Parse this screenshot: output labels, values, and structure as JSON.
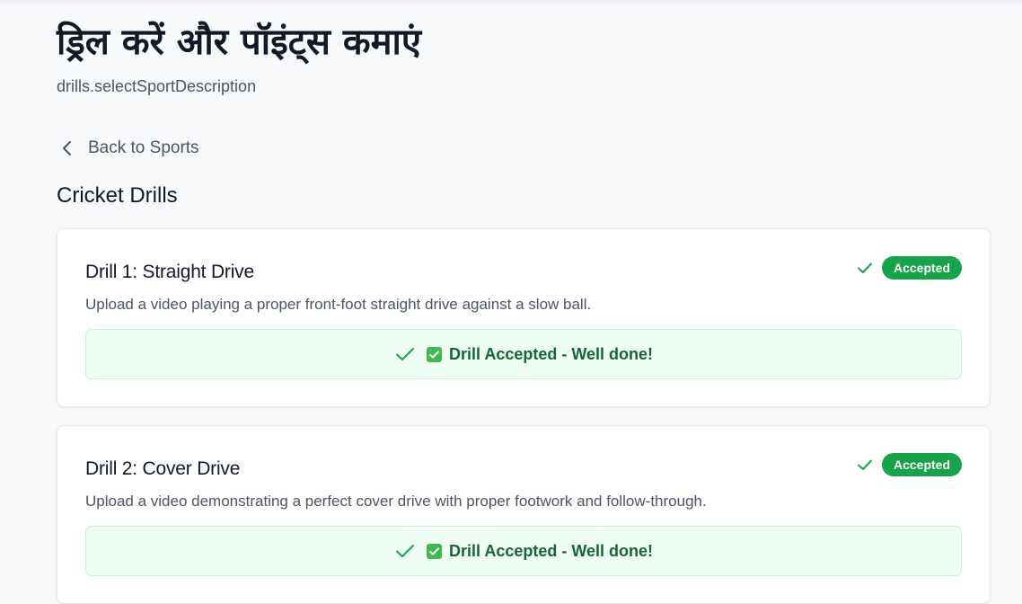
{
  "header": {
    "title": "ड्रिल करें और पॉइंट्स कमाएं",
    "subtitle": "drills.selectSportDescription"
  },
  "nav": {
    "back_icon": "chevron-left-icon",
    "back_label": "Back to Sports"
  },
  "section": {
    "title": "Cricket Drills"
  },
  "colors": {
    "accepted_badge": "#16a34a",
    "accepted_box_bg": "#effdf4",
    "accepted_text": "#166534"
  },
  "drills": [
    {
      "title": "Drill 1: Straight Drive",
      "description": "Upload a video playing a proper front-foot straight drive against a slow ball.",
      "status_icon": "check-icon",
      "status": "Accepted",
      "result_message": "Drill Accepted - Well done!"
    },
    {
      "title": "Drill 2: Cover Drive",
      "description": "Upload a video demonstrating a perfect cover drive with proper footwork and follow-through.",
      "status_icon": "check-icon",
      "status": "Accepted",
      "result_message": "Drill Accepted - Well done!"
    }
  ]
}
